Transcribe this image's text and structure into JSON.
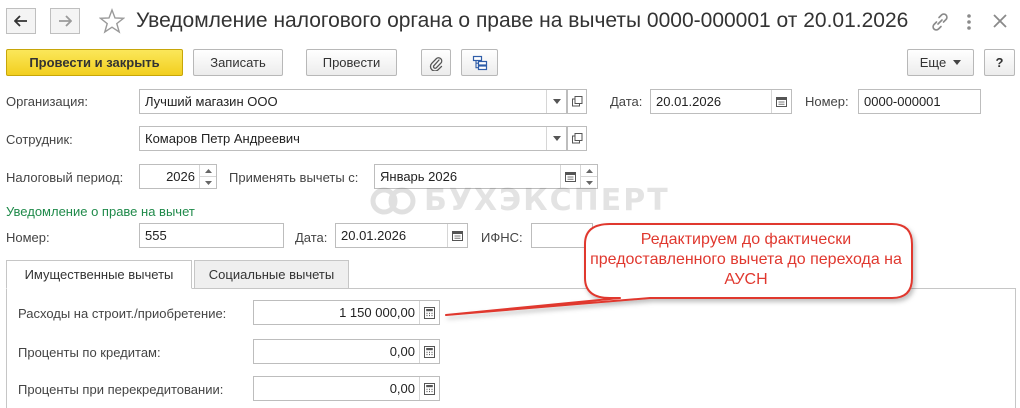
{
  "header": {
    "title": "Уведомление налогового органа о праве на вычеты 0000-000001 от 20.01.2026",
    "back_icon": "arrow-left-icon",
    "forward_icon": "arrow-right-icon",
    "favorite_icon": "star-icon",
    "link_icon": "link-icon",
    "menu_icon": "vertical-dots-icon",
    "close_icon": "close-icon"
  },
  "toolbar": {
    "post_close_label": "Провести и закрыть",
    "save_label": "Записать",
    "post_label": "Провести",
    "attach_icon": "paperclip-icon",
    "structure_icon": "document-structure-icon",
    "more_label": "Еще",
    "help_label": "?"
  },
  "form": {
    "organization_label": "Организация:",
    "organization_value": "Лучший магазин ООО",
    "date_label": "Дата:",
    "date_value": "20.01.2026",
    "number_label": "Номер:",
    "number_value": "0000-000001",
    "employee_label": "Сотрудник:",
    "employee_value": "Комаров Петр Андреевич",
    "tax_period_label": "Налоговый период:",
    "tax_period_value": "2026",
    "apply_from_label": "Применять вычеты с:",
    "apply_from_value": "Январь 2026"
  },
  "notification": {
    "section_title": "Уведомление о праве на вычет",
    "number_label": "Номер:",
    "number_value": "555",
    "date_label": "Дата:",
    "date_value": "20.01.2026",
    "ifns_label": "ИФНС:",
    "ifns_value": ""
  },
  "tabs": [
    {
      "label": "Имущественные вычеты",
      "active": true
    },
    {
      "label": "Социальные вычеты",
      "active": false
    }
  ],
  "property": {
    "rows": [
      {
        "label": "Расходы на строит./приобретение:",
        "value": "1 150 000,00"
      },
      {
        "label": "Проценты по кредитам:",
        "value": "0,00"
      },
      {
        "label": "Проценты при перекредитовании:",
        "value": "0,00"
      }
    ]
  },
  "callout": {
    "text": "Редактируем до фактически предоставленного вычета до перехода на АУСН",
    "color": "#e0382f"
  },
  "watermark": {
    "text": "БУХЭКСПЕРТ"
  },
  "colors": {
    "primary_button": "#f6d72e",
    "section_title": "#1f8a4a",
    "callout_text": "#e0382f"
  }
}
